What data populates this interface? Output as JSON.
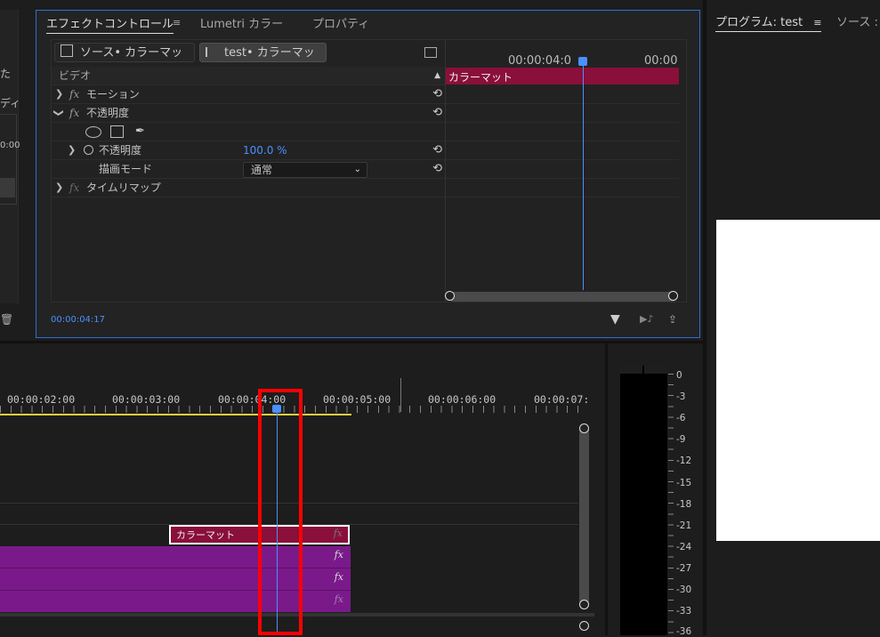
{
  "left_panel": {
    "frag1": "た",
    "frag2": "ディ",
    "frag3": "0:00"
  },
  "effect_controls": {
    "tabs": [
      "エフェクトコントロール",
      "Lumetri カラー",
      "プロパティ"
    ],
    "menu_glyph": "≡",
    "source_button": "ソース• カラーマット",
    "target_button": "test• カラーマット",
    "section_label": "ビデオ",
    "rows": {
      "motion": "モーション",
      "opacity": "不透明度",
      "opacity_prop": "不透明度",
      "opacity_value": "100.0 %",
      "blend_mode_label": "描画モード",
      "blend_mode_value": "通常",
      "time_remap": "タイムリマップ"
    },
    "timecode_left": "00:00:04:0",
    "timecode_right": "00:00",
    "clip_label": "カラーマット",
    "current_time": "00:00:04:17",
    "fx_glyph": "fx"
  },
  "program": {
    "title": "プログラム: test",
    "menu_glyph": "≡",
    "source_tab": "ソース :"
  },
  "timeline": {
    "ruler": [
      "00:00:02:00",
      "00:00:03:00",
      "00:00:04:00",
      "00:00:05:00",
      "00:00:06:00",
      "00:00:07:"
    ],
    "clip_label": "カラーマット",
    "fx_glyph": "fx"
  },
  "audio_meter": {
    "labels": [
      "0",
      "-3",
      "-6",
      "-9",
      "-12",
      "-15",
      "-18",
      "-21",
      "-24",
      "-27",
      "-30",
      "-33",
      "-36"
    ]
  },
  "colors": {
    "accent_blue": "#2f6fd1",
    "clip_red": "#8a0f3a",
    "clip_purple": "#7a1a8a",
    "highlight_red": "#ff0000",
    "playhead": "#4a90ff"
  }
}
